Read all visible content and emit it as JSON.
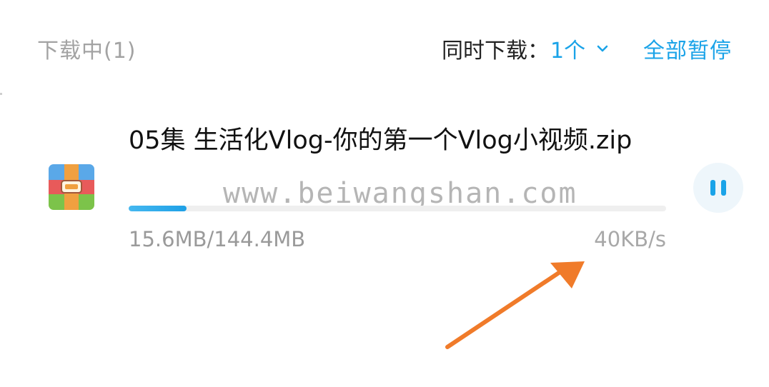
{
  "header": {
    "downloading_title": "下载中(1)",
    "concurrent_label": "同时下载：",
    "concurrent_value": "1个",
    "pause_all_label": "全部暂停"
  },
  "download_item": {
    "file_name": "05集 生活化Vlog-你的第一个Vlog小视频.zip",
    "progress_fraction": 0.108,
    "size_text": "15.6MB/144.4MB",
    "speed_text": "40KB/s",
    "icon": "zip-archive-icon",
    "action_icon": "pause-icon"
  },
  "watermark": {
    "text": "www.beiwangshan.com"
  },
  "colors": {
    "accent": "#1aa3e8",
    "annotation_arrow": "#f07b2a"
  }
}
